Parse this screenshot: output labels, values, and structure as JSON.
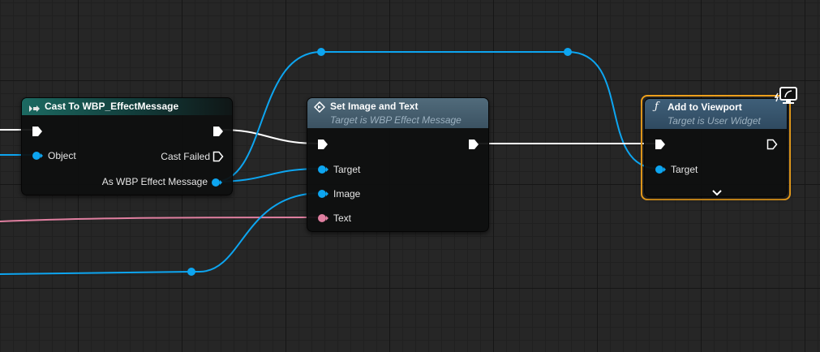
{
  "colors": {
    "exec": "#ffffff",
    "object_pin": "#0da5f0",
    "text_pin": "#e07fa0",
    "selection": "#f1a31d",
    "cast_header": "#1c6a62",
    "function_header": "#4a6373"
  },
  "nodes": {
    "cast": {
      "title": "Cast To WBP_EffectMessage",
      "icon": "cast-icon",
      "pins": {
        "object": "Object",
        "cast_failed": "Cast Failed",
        "as_wbp": "As WBP Effect Message"
      }
    },
    "set_image": {
      "title": "Set Image and Text",
      "subtitle": "Target is WBP Effect Message",
      "icon": "function-diamond-icon",
      "pins": {
        "target": "Target",
        "image": "Image",
        "text": "Text"
      }
    },
    "add_viewport": {
      "title": "Add to Viewport",
      "subtitle": "Target is User Widget",
      "icon": "function-f-icon",
      "badge_icon": "client-only-monitor-icon",
      "expand_icon": "chevron-down-icon",
      "selected": true,
      "pins": {
        "target": "Target"
      }
    }
  }
}
